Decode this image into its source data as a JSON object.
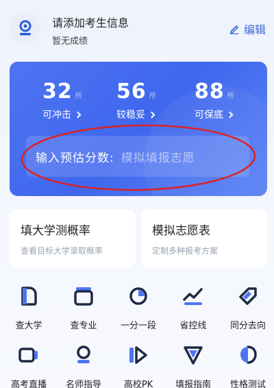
{
  "header": {
    "title": "请添加考生信息",
    "subtitle": "暂无成绩",
    "edit_label": "编辑"
  },
  "stats": [
    {
      "value": "32",
      "unit": "所",
      "label": "可冲击"
    },
    {
      "value": "56",
      "unit": "所",
      "label": "较稳妥"
    },
    {
      "value": "88",
      "unit": "所",
      "label": "可保底"
    }
  ],
  "score_input": {
    "label": "输入预估分数:",
    "placeholder": "模拟填报志愿"
  },
  "tiles": [
    {
      "title": "填大学测概率",
      "subtitle": "查看目标大学录取概率"
    },
    {
      "title": "模拟志愿表",
      "subtitle": "定制多种报考方案"
    }
  ],
  "grid": [
    {
      "label": "查大学",
      "icon": "university-icon"
    },
    {
      "label": "查专业",
      "icon": "major-icon"
    },
    {
      "label": "一分一段",
      "icon": "score-segment-icon"
    },
    {
      "label": "省控线",
      "icon": "trend-line-icon"
    },
    {
      "label": "同分去向",
      "icon": "tag-icon"
    },
    {
      "label": "高考直播",
      "icon": "live-video-icon"
    },
    {
      "label": "名师指导",
      "icon": "teacher-icon"
    },
    {
      "label": "高校PK",
      "icon": "pk-icon"
    },
    {
      "label": "填报指南",
      "icon": "guide-icon"
    },
    {
      "label": "性格测试",
      "icon": "personality-test-icon"
    }
  ],
  "colors": {
    "primary": "#3f67ee",
    "accent": "#3c6bdc",
    "annotation_red": "#d22"
  }
}
